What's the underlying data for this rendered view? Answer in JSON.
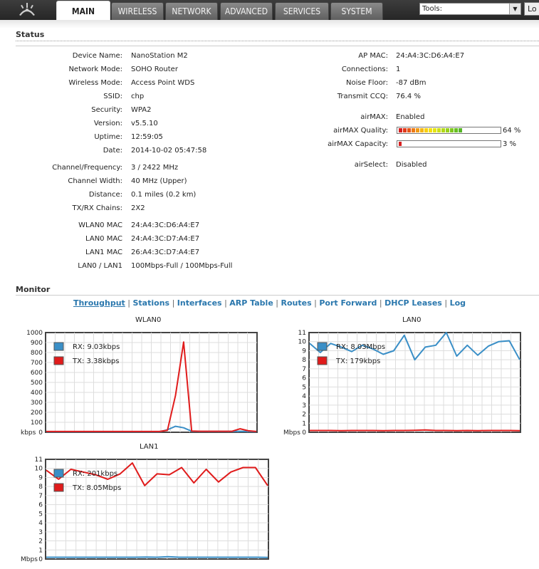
{
  "nav": {
    "tabs": [
      "MAIN",
      "WIRELESS",
      "NETWORK",
      "ADVANCED",
      "SERVICES",
      "SYSTEM"
    ],
    "active_tab": "MAIN",
    "tools_select": "Tools:",
    "logout_label": "Lo"
  },
  "status": {
    "title": "Status",
    "left": [
      {
        "label": "Device Name:",
        "value": "NanoStation M2"
      },
      {
        "label": "Network Mode:",
        "value": "SOHO Router"
      },
      {
        "label": "Wireless Mode:",
        "value": "Access Point WDS"
      },
      {
        "label": "SSID:",
        "value": "chp"
      },
      {
        "label": "Security:",
        "value": "WPA2"
      },
      {
        "label": "Version:",
        "value": "v5.5.10"
      },
      {
        "label": "Uptime:",
        "value": "12:59:05"
      },
      {
        "label": "Date:",
        "value": "2014-10-02 05:47:58"
      },
      {
        "label": "Channel/Frequency:",
        "value": "3 / 2422 MHz"
      },
      {
        "label": "Channel Width:",
        "value": "40 MHz (Upper)"
      },
      {
        "label": "Distance:",
        "value": "0.1 miles (0.2 km)"
      },
      {
        "label": "TX/RX Chains:",
        "value": "2X2"
      },
      {
        "label": "WLAN0 MAC",
        "value": "24:A4:3C:D6:A4:E7"
      },
      {
        "label": "LAN0 MAC",
        "value": "24:A4:3C:D7:A4:E7"
      },
      {
        "label": "LAN1 MAC",
        "value": "26:A4:3C:D7:A4:E7"
      },
      {
        "label": "LAN0 / LAN1",
        "value": "100Mbps-Full / 100Mbps-Full"
      }
    ],
    "right": [
      {
        "label": "AP MAC:",
        "value": "24:A4:3C:D6:A4:E7"
      },
      {
        "label": "Connections:",
        "value": "1"
      },
      {
        "label": "Noise Floor:",
        "value": "-87 dBm"
      },
      {
        "label": "Transmit CCQ:",
        "value": "76.4 %"
      },
      {
        "label": "airMAX:",
        "value": "Enabled"
      },
      {
        "label": "airMAX Quality:",
        "value": "64 %",
        "level": 0.64
      },
      {
        "label": "airMAX Capacity:",
        "value": "3 %",
        "level": 0.03
      },
      {
        "label": "airSelect:",
        "value": "Disabled"
      }
    ]
  },
  "monitor": {
    "title": "Monitor",
    "links": [
      "Throughput",
      "Stations",
      "Interfaces",
      "ARP Table",
      "Routes",
      "Port Forward",
      "DHCP Leases",
      "Log"
    ],
    "active_link": "Throughput"
  },
  "colors": {
    "rx": "#3a8fc7",
    "tx": "#e01b1b"
  },
  "chart_data": [
    {
      "type": "line",
      "title": "WLAN0",
      "ylabel": "kbps",
      "ylim": [
        0,
        1000
      ],
      "yticks": [
        "1000",
        "900",
        "800",
        "700",
        "600",
        "500",
        "400",
        "300",
        "200",
        "100",
        "0"
      ],
      "series": [
        {
          "name": "RX: 9.03kbps",
          "values": [
            5,
            5,
            5,
            5,
            5,
            5,
            5,
            5,
            5,
            5,
            5,
            5,
            5,
            5,
            5,
            25,
            60,
            45,
            10,
            8,
            8,
            8,
            8,
            8,
            10,
            8,
            5
          ]
        },
        {
          "name": "TX: 3.38kbps",
          "values": [
            8,
            8,
            8,
            8,
            8,
            8,
            8,
            8,
            8,
            8,
            8,
            8,
            8,
            8,
            8,
            20,
            370,
            905,
            12,
            10,
            10,
            10,
            10,
            10,
            35,
            15,
            8
          ]
        }
      ]
    },
    {
      "type": "line",
      "title": "LAN0",
      "ylabel": "Mbps",
      "ylim": [
        0,
        11
      ],
      "yticks": [
        "11",
        "10",
        "9",
        "8",
        "7",
        "6",
        "5",
        "4",
        "3",
        "2",
        "1",
        "0"
      ],
      "series": [
        {
          "name": "RX: 8.03Mbps",
          "values": [
            9.8,
            8.8,
            9.8,
            9.4,
            8.9,
            9.6,
            9.2,
            8.6,
            9.0,
            10.7,
            8.0,
            9.4,
            9.6,
            11.0,
            8.4,
            9.6,
            8.5,
            9.5,
            10.0,
            10.1,
            8.0
          ]
        },
        {
          "name": "TX: 179kbps",
          "values": [
            0.2,
            0.2,
            0.2,
            0.18,
            0.2,
            0.2,
            0.2,
            0.18,
            0.2,
            0.2,
            0.22,
            0.25,
            0.2,
            0.2,
            0.18,
            0.2,
            0.18,
            0.2,
            0.2,
            0.2,
            0.18
          ]
        }
      ]
    },
    {
      "type": "line",
      "title": "LAN1",
      "ylabel": "Mbps",
      "ylim": [
        0,
        11
      ],
      "yticks": [
        "11",
        "10",
        "9",
        "8",
        "7",
        "6",
        "5",
        "4",
        "3",
        "2",
        "1",
        "0"
      ],
      "series": [
        {
          "name": "RX: 201kbps",
          "values": [
            0.2,
            0.2,
            0.2,
            0.2,
            0.2,
            0.2,
            0.2,
            0.2,
            0.2,
            0.22,
            0.2,
            0.25,
            0.2,
            0.2,
            0.2,
            0.2,
            0.2,
            0.2,
            0.2,
            0.2,
            0.18
          ]
        },
        {
          "name": "TX: 8.05Mbps",
          "values": [
            9.8,
            8.8,
            9.9,
            9.6,
            9.3,
            8.8,
            9.4,
            10.6,
            8.1,
            9.4,
            9.3,
            10.1,
            8.4,
            9.9,
            8.5,
            9.6,
            10.1,
            10.1,
            8.1
          ]
        }
      ]
    }
  ]
}
